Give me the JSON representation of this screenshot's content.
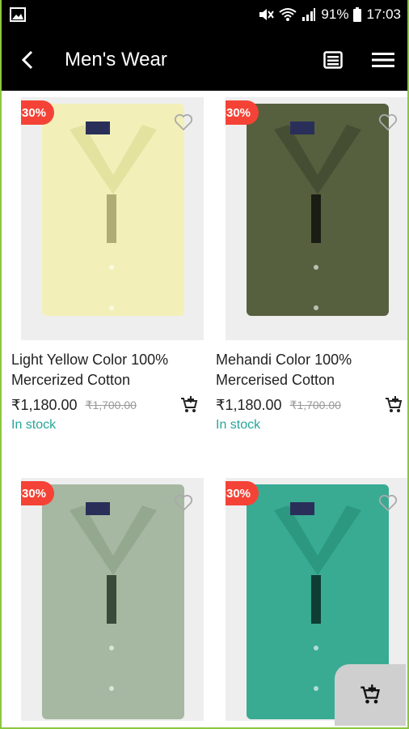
{
  "status": {
    "battery": "91%",
    "time": "17:03"
  },
  "appbar": {
    "title": "Men's Wear"
  },
  "products": [
    {
      "discount": "-30%",
      "name": "Light Yellow Color 100% Mercerized Cotton",
      "price": "₹1,180.00",
      "old_price": "₹1,700.00",
      "stock": "In stock",
      "shirt_color": "#f2f0b8",
      "shirt_shade": "#e4e29f"
    },
    {
      "discount": "-30%",
      "name": "Mehandi Color 100% Mercerised Cotton",
      "price": "₹1,180.00",
      "old_price": "₹1,700.00",
      "stock": "In stock",
      "shirt_color": "#56603f",
      "shirt_shade": "#454e33"
    },
    {
      "discount": "-30%",
      "shirt_color": "#a6b8a1",
      "shirt_shade": "#94a78f"
    },
    {
      "discount": "-30%",
      "shirt_color": "#39ab93",
      "shirt_shade": "#2c9880"
    }
  ],
  "colors": {
    "badge": "#f44336",
    "in_stock": "#26a69a",
    "frame": "#8cc63f"
  }
}
